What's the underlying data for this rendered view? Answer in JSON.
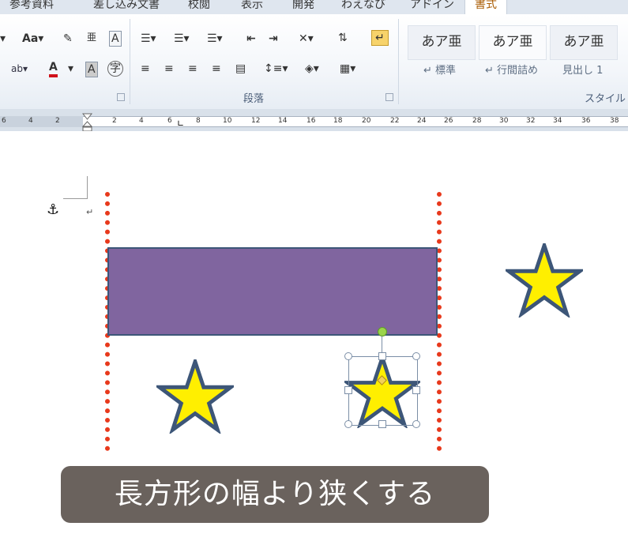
{
  "tabs": [
    "参考資料",
    "差し込み文書",
    "校閲",
    "表示",
    "開発",
    "わえなび",
    "アドイン",
    "書式"
  ],
  "ribbon": {
    "font_group": {
      "size_btn": "Aa",
      "phonetic": "亜",
      "box": "A",
      "highlight": "ab",
      "color_a": "A",
      "shade_a": "A",
      "enclose": "字"
    },
    "para_group_label": "段落",
    "styles_group_label": "スタイル",
    "styles": [
      {
        "preview": "あア亜",
        "caption": "↵ 標準"
      },
      {
        "preview": "あア亜",
        "caption": "↵ 行間詰め"
      },
      {
        "preview": "あア亜",
        "caption": "見出し 1"
      }
    ]
  },
  "ruler_numbers": [
    "6",
    "4",
    "2",
    "2",
    "4",
    "6",
    "8",
    "10",
    "12",
    "14",
    "16",
    "18",
    "20",
    "22",
    "24",
    "26",
    "28",
    "30",
    "32",
    "34",
    "36",
    "38"
  ],
  "document": {
    "paragraph_mark": "↵",
    "anchor_icon": "⚓"
  },
  "caption": "長方形の幅より狭くする",
  "colors": {
    "rectangle_fill": "#80659f",
    "star_fill": "#ffef00",
    "star_stroke": "#3d5678",
    "guide_line": "#e8391c"
  }
}
